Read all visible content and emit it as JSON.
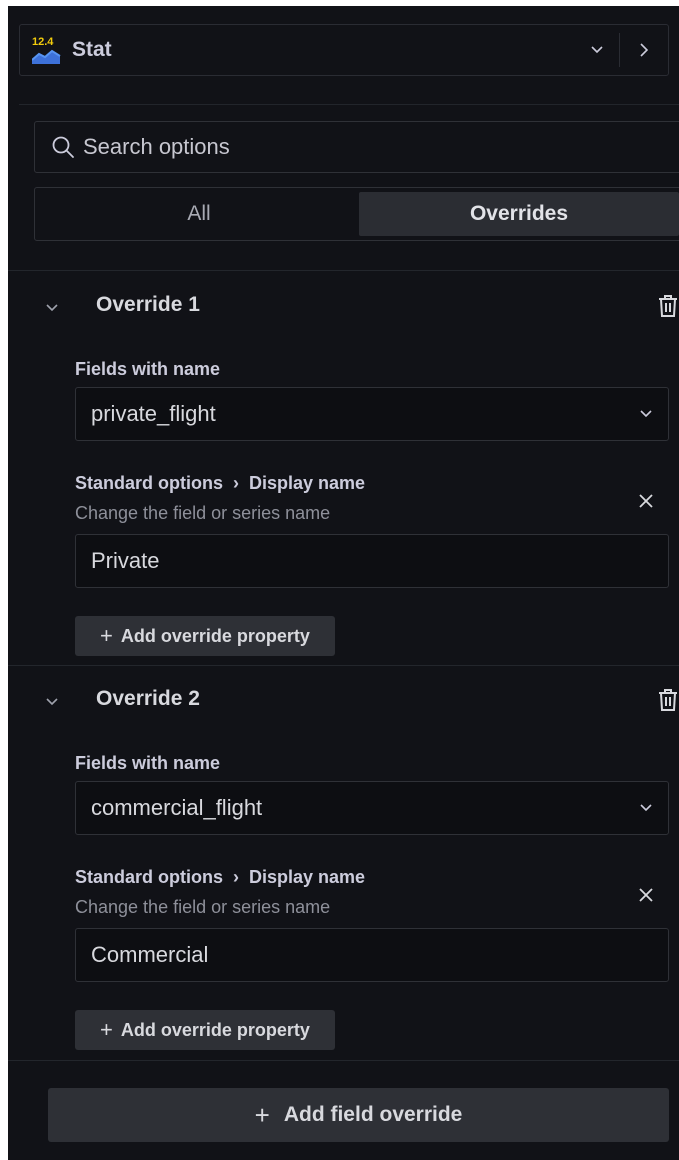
{
  "visualization": {
    "icon_number": "12.4",
    "name": "Stat",
    "icon": "stat-viz-icon",
    "dropdown_icon": "chevron-down-icon",
    "next_icon": "chevron-right-icon"
  },
  "search": {
    "placeholder": "Search options",
    "value": ""
  },
  "tabs": [
    {
      "label": "All",
      "active": false
    },
    {
      "label": "Overrides",
      "active": true
    }
  ],
  "overrides": [
    {
      "title": "Override 1",
      "matcher_label": "Fields with name",
      "matcher_value": "private_flight",
      "property": {
        "category": "Standard options",
        "name": "Display name",
        "description": "Change the field or series name",
        "value": "Private"
      },
      "add_property_label": "Add override property"
    },
    {
      "title": "Override 2",
      "matcher_label": "Fields with name",
      "matcher_value": "commercial_flight",
      "property": {
        "category": "Standard options",
        "name": "Display name",
        "description": "Change the field or series name",
        "value": "Commercial"
      },
      "add_property_label": "Add override property"
    }
  ],
  "add_field_override_label": "Add field override",
  "colors": {
    "background": "#111217",
    "border": "#2f3137",
    "button_bg": "#2e3036",
    "text": "#ccccdc",
    "muted_text": "#8e909a",
    "stat_icon_yellow": "#f2cc0c",
    "stat_icon_blue": "#3d71d9"
  }
}
